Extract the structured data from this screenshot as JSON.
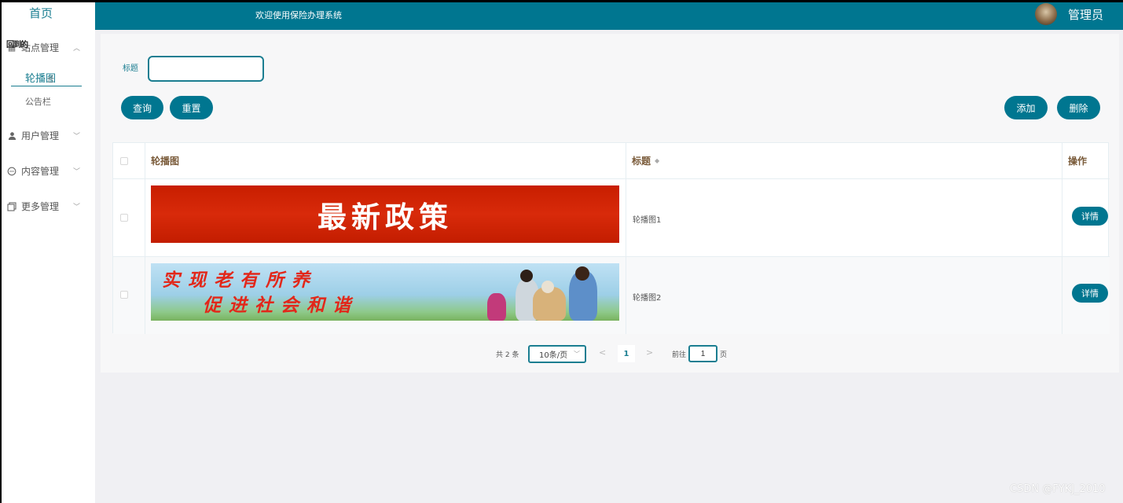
{
  "sidebar": {
    "home": "首页",
    "overlap_text": "回到的",
    "menus": [
      {
        "label": "站点管理",
        "icon": "grid-icon",
        "chevron": "^"
      },
      {
        "label": "用户管理",
        "icon": "user-icon",
        "chevron": "v"
      },
      {
        "label": "内容管理",
        "icon": "chat-icon",
        "chevron": "v"
      },
      {
        "label": "更多管理",
        "icon": "copy-icon",
        "chevron": "v"
      }
    ],
    "sub_items": [
      "轮播图",
      "公告栏"
    ]
  },
  "header": {
    "welcome": "欢迎使用保险办理系统",
    "admin": "管理员"
  },
  "search": {
    "label": "标题",
    "value": "",
    "query_btn": "查询",
    "reset_btn": "重置",
    "add_btn": "添加",
    "delete_btn": "删除"
  },
  "table": {
    "columns": [
      "轮播图",
      "标题",
      "操作"
    ],
    "sort_glyph": "◆",
    "rows": [
      {
        "banner_text": "最新政策",
        "title": "轮播图1",
        "action": "详情"
      },
      {
        "banner_line1": "实现老有所养",
        "banner_line2": "促进社会和谐",
        "title": "轮播图2",
        "action": "详情"
      }
    ]
  },
  "pagination": {
    "total": "共 2 条",
    "page_size": "10条/页",
    "prev": "<",
    "current": "1",
    "next": ">",
    "goto_label": "前往",
    "goto_value": "1",
    "page_label": "页"
  },
  "watermark": "CSDN @FYKJ_2010",
  "colors": {
    "primary": "#007690",
    "accent": "#1b7e91"
  }
}
